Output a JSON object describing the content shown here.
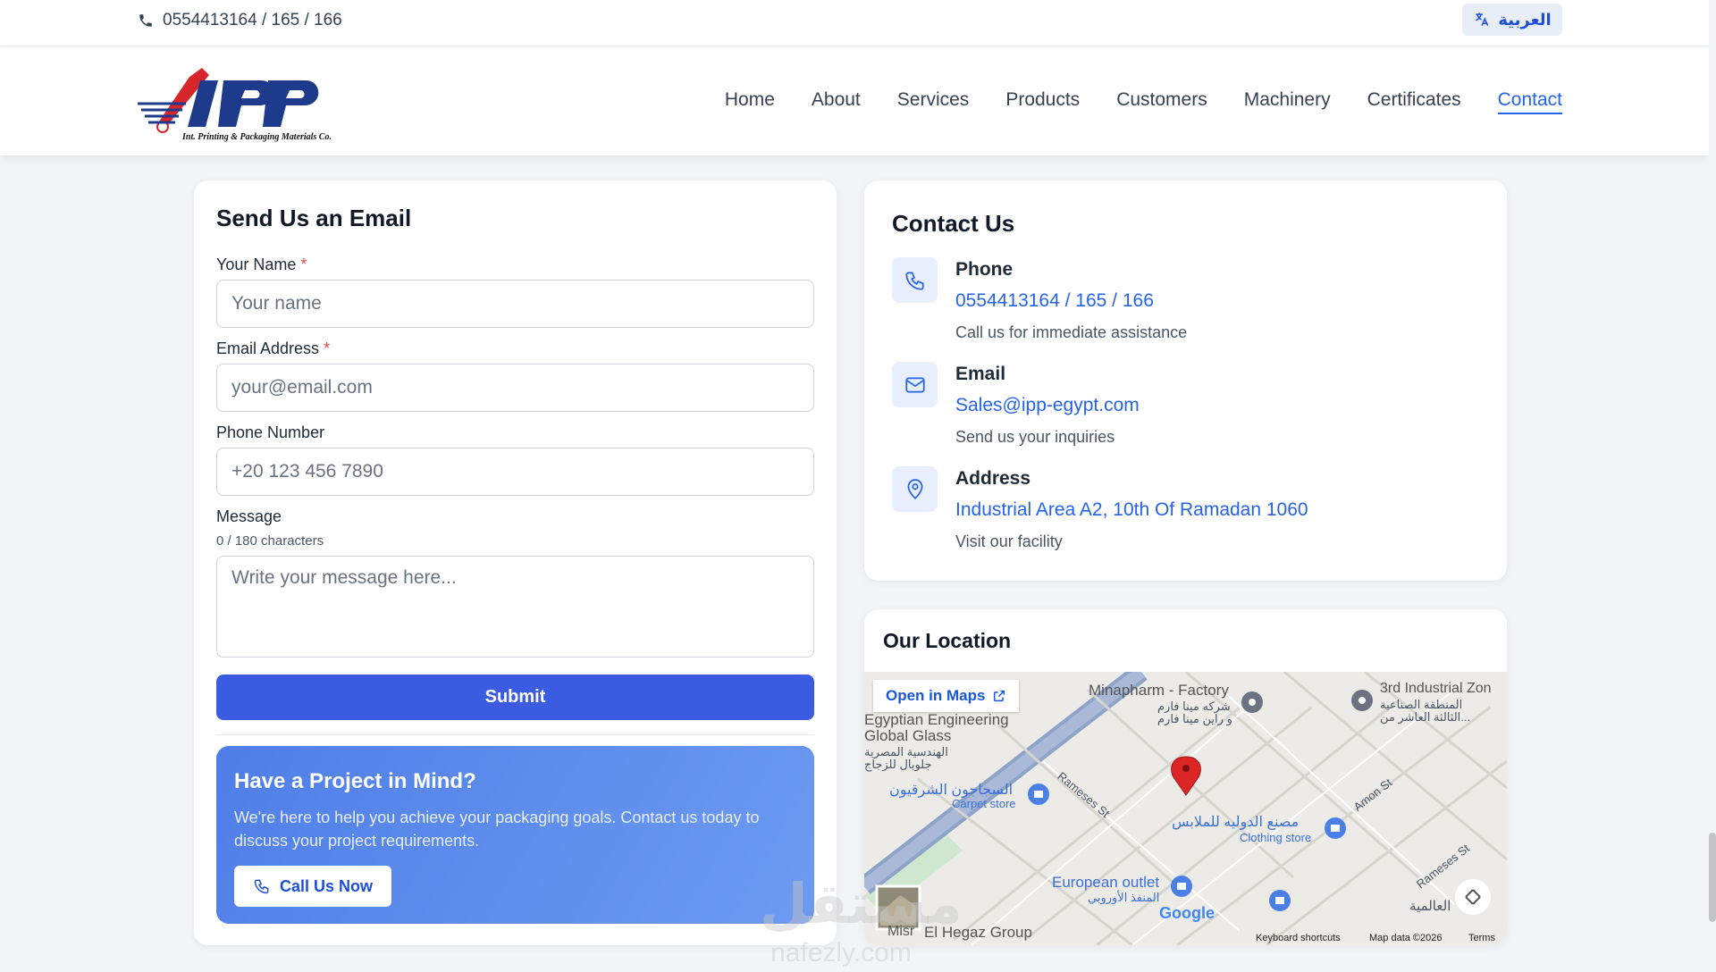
{
  "topbar": {
    "phone": "0554413164 / 165 / 166",
    "language": "العربية"
  },
  "header": {
    "logo_text": "IPP",
    "logo_subtitle": "Int. Printing & Packaging Materials Co.",
    "nav": [
      {
        "label": "Home"
      },
      {
        "label": "About"
      },
      {
        "label": "Services"
      },
      {
        "label": "Products"
      },
      {
        "label": "Customers"
      },
      {
        "label": "Machinery"
      },
      {
        "label": "Certificates"
      },
      {
        "label": "Contact"
      }
    ],
    "active_nav": "Contact"
  },
  "form": {
    "title": "Send Us an Email",
    "name_label": "Your Name",
    "name_placeholder": "Your name",
    "email_label": "Email Address",
    "email_placeholder": "your@email.com",
    "phone_label": "Phone Number",
    "phone_placeholder": "+20 123 456 7890",
    "message_label": "Message",
    "message_counter": "0 / 180 characters",
    "message_placeholder": "Write your message here...",
    "required_mark": "*",
    "submit_label": "Submit"
  },
  "promo": {
    "title": "Have a Project in Mind?",
    "text": "We're here to help you achieve your packaging goals. Contact us today to discuss your project requirements.",
    "button_label": "Call Us Now"
  },
  "contact": {
    "title": "Contact Us",
    "items": [
      {
        "title": "Phone",
        "value": "0554413164 / 165 / 166",
        "sub": "Call us for immediate assistance",
        "icon": "phone-icon"
      },
      {
        "title": "Email",
        "value": "Sales@ipp-egypt.com",
        "sub": "Send us your inquiries",
        "icon": "mail-icon"
      },
      {
        "title": "Address",
        "value": "Industrial Area A2, 10th Of Ramadan 1060",
        "sub": "Visit our facility",
        "icon": "map-pin-icon"
      }
    ]
  },
  "location": {
    "title": "Our Location",
    "open_maps": "Open in Maps",
    "labels": {
      "minapharm": "Minapharm - Factory",
      "minapharm_ar": "شركه مينا فارم",
      "minapharm_ar2": "و راين مينا فارم",
      "industrial_zone": "3rd Industrial Zon",
      "industrial_zone_ar": "المنطقة الصناعية",
      "industrial_zone_ar2": "الثالثة العاشر من...",
      "egyptian_eng": "Egyptian Engineering",
      "global_glass": "Global Glass",
      "global_glass_ar": "الهندسية المصرية",
      "global_glass_ar2": "جلوبال للزجاج",
      "carpet_store_ar": "السجاجون الشرقيون",
      "carpet_store": "Carpet store",
      "factory_ar": "مصنع الدوليه للملابس",
      "clothing_store": "Clothing store",
      "european_outlet": "European outlet",
      "european_outlet_ar": "المنفذ الأوروبي",
      "rameses_st": "Rameses St",
      "rameses_st2": "Rameses St",
      "amon_st": "Amon St",
      "hegaz_group": "El Hegaz Group",
      "misr": "Misr",
      "alamia": "العالمية",
      "google": "Google"
    },
    "footer": {
      "shortcuts": "Keyboard shortcuts",
      "map_data": "Map data ©2026",
      "terms": "Terms"
    }
  },
  "watermark": {
    "arabic": "مستقل",
    "latin": "nafezly.com"
  },
  "colors": {
    "accent": "#2563eb",
    "submit": "#3b5be0",
    "required": "#ef4444",
    "pin": "#dc2626"
  }
}
